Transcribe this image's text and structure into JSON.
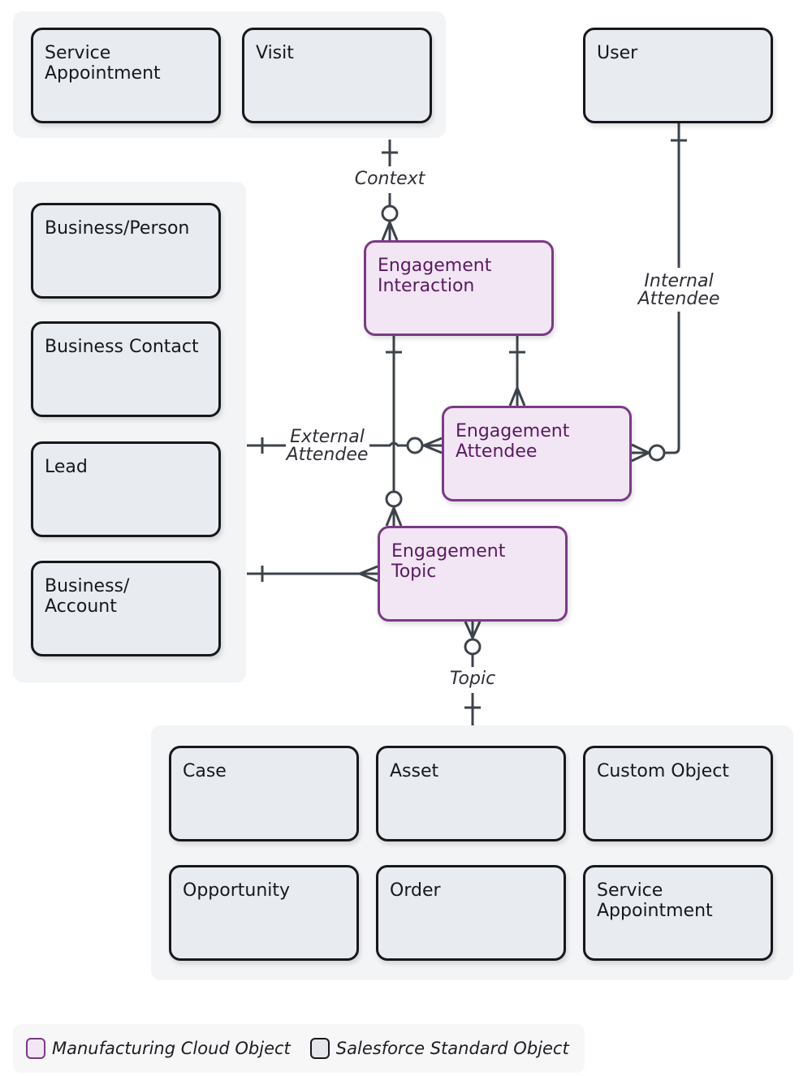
{
  "diagram": {
    "groups": {
      "context_group": [
        "Service\nAppointment",
        "Visit"
      ],
      "user": "User",
      "attendee_group": [
        "Business/Person",
        "Business Contact",
        "Lead",
        "Business/\nAccount"
      ],
      "topic_group": [
        "Case",
        "Asset",
        "Custom Object",
        "Opportunity",
        "Order",
        "Service\nAppointment"
      ]
    },
    "manufacturing_objects": {
      "engagement_interaction": "Engagement\nInteraction",
      "engagement_attendee": "Engagement\nAttendee",
      "engagement_topic": "Engagement\nTopic"
    },
    "relationships": {
      "context": "Context",
      "internal_attendee": "Internal\nAttendee",
      "external_attendee": "External\nAttendee",
      "topic": "Topic"
    },
    "legend": {
      "manufacturing": "Manufacturing Cloud Object",
      "standard": "Salesforce Standard Object"
    },
    "colors": {
      "manufacturing_border": "#7b3a86",
      "manufacturing_fill": "#f2e6f4",
      "standard_border": "#16181c",
      "standard_fill": "#e8ebf0",
      "connector": "#3d434b"
    }
  }
}
